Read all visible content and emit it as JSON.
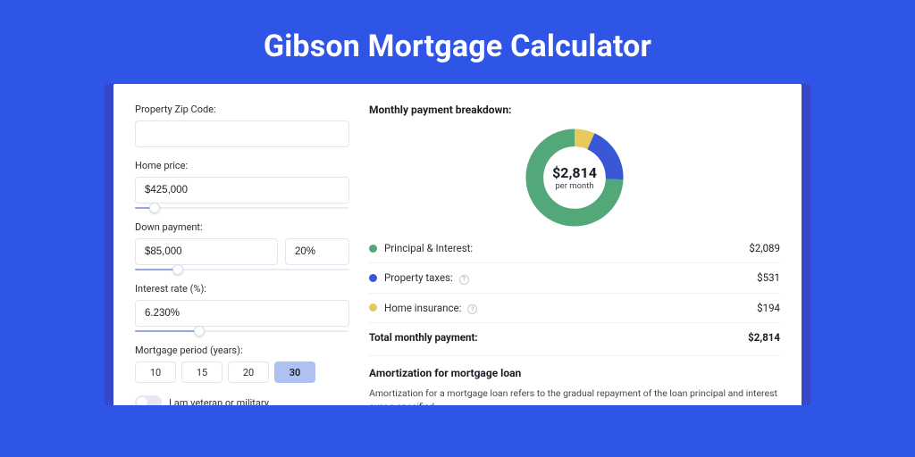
{
  "title": "Gibson Mortgage Calculator",
  "form": {
    "zip_label": "Property Zip Code:",
    "zip_value": "",
    "home_price_label": "Home price:",
    "home_price_value": "$425,000",
    "home_price_slider_pct": 9,
    "down_label": "Down payment:",
    "down_value": "$85,000",
    "down_pct_value": "20%",
    "down_slider_pct": 20,
    "rate_label": "Interest rate (%):",
    "rate_value": "6.230%",
    "rate_slider_pct": 30,
    "period_label": "Mortgage period (years):",
    "period_options": [
      "10",
      "15",
      "20",
      "30"
    ],
    "period_selected": "30",
    "veteran_label": "I am veteran or military",
    "veteran_on": false
  },
  "breakdown": {
    "title": "Monthly payment breakdown:",
    "center_amount": "$2,814",
    "center_sub": "per month",
    "rows": [
      {
        "name": "Principal & Interest:",
        "amount": "$2,089",
        "color": "g",
        "info": false
      },
      {
        "name": "Property taxes:",
        "amount": "$531",
        "color": "b",
        "info": true
      },
      {
        "name": "Home insurance:",
        "amount": "$194",
        "color": "y",
        "info": true
      }
    ],
    "total_label": "Total monthly payment:",
    "total_amount": "$2,814"
  },
  "chart_data": {
    "type": "pie",
    "title": "Monthly payment breakdown",
    "series": [
      {
        "name": "Principal & Interest",
        "value": 2089,
        "color": "#52a879"
      },
      {
        "name": "Property taxes",
        "value": 531,
        "color": "#3858d6"
      },
      {
        "name": "Home insurance",
        "value": 194,
        "color": "#e7c95e"
      }
    ],
    "total": 2814,
    "unit": "USD/month"
  },
  "amortization": {
    "title": "Amortization for mortgage loan",
    "body": "Amortization for a mortgage loan refers to the gradual repayment of the loan principal and interest over a specified"
  }
}
